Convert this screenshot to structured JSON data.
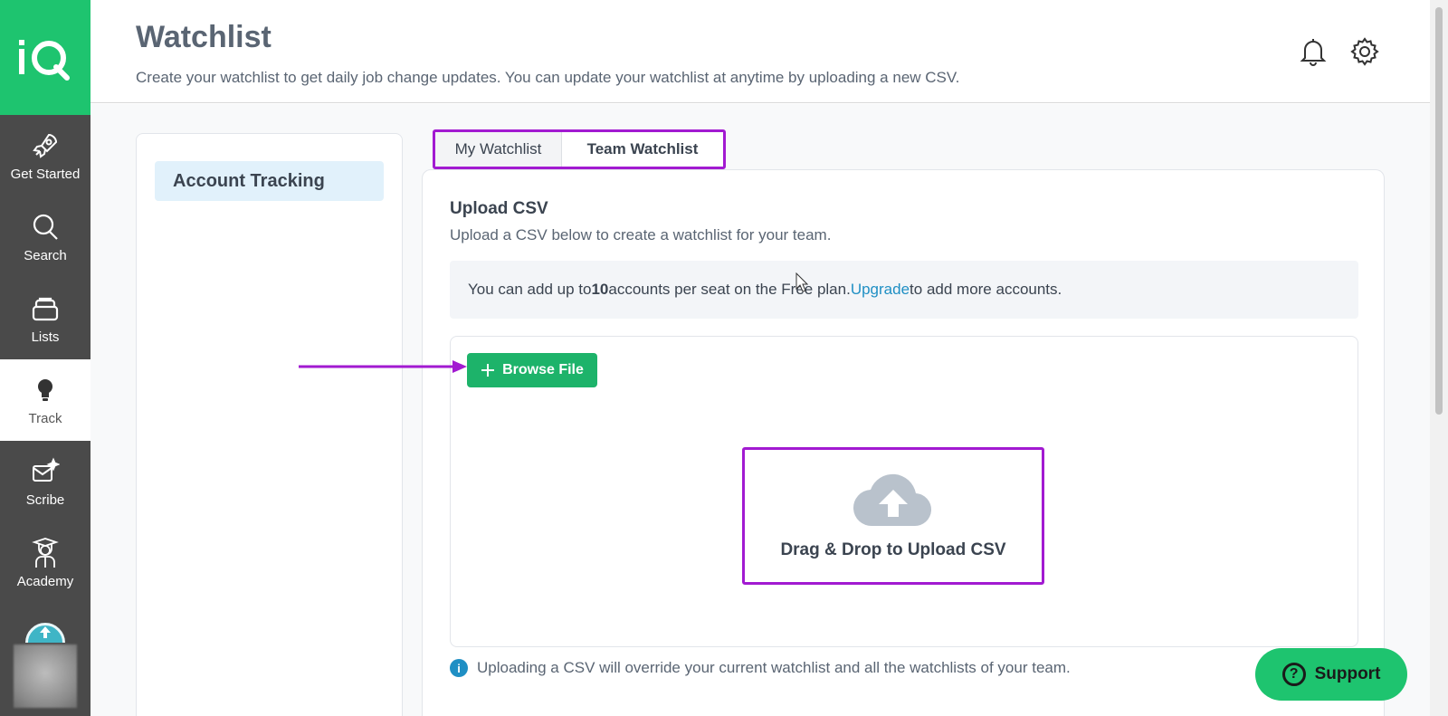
{
  "app": {
    "logo_text": "iQ"
  },
  "sidebar": {
    "items": [
      {
        "label": "Get Started",
        "icon": "rocket-icon"
      },
      {
        "label": "Search",
        "icon": "search-icon"
      },
      {
        "label": "Lists",
        "icon": "stack-icon"
      },
      {
        "label": "Track",
        "icon": "lightbulb-icon",
        "active": true
      },
      {
        "label": "Scribe",
        "icon": "mail-sparkle-icon"
      },
      {
        "label": "Academy",
        "icon": "graduate-icon"
      }
    ]
  },
  "header": {
    "title": "Watchlist",
    "subtitle": "Create your watchlist to get daily job change updates. You can update your watchlist at anytime by uploading a new CSV."
  },
  "left_panel": {
    "item": "Account Tracking"
  },
  "tabs": [
    {
      "label": "My Watchlist"
    },
    {
      "label": "Team Watchlist",
      "active": true
    }
  ],
  "upload": {
    "title": "Upload CSV",
    "subtitle": "Upload a CSV below to create a watchlist for your team.",
    "notice": {
      "prefix": "You can add up to ",
      "count": "10",
      "middle": " accounts per seat on the Free plan. ",
      "link": "Upgrade",
      "suffix": " to add more accounts."
    },
    "browse_label": "Browse File",
    "drop_label": "Drag & Drop to Upload CSV",
    "footnote": "Uploading a CSV will override your current watchlist and all the watchlists of your team."
  },
  "support": {
    "label": "Support"
  },
  "colors": {
    "brand_green": "#1ec46f",
    "sidebar_bg": "#4a4a4a",
    "highlight_purple": "#a21ad1",
    "link_blue": "#1f8fc4"
  }
}
